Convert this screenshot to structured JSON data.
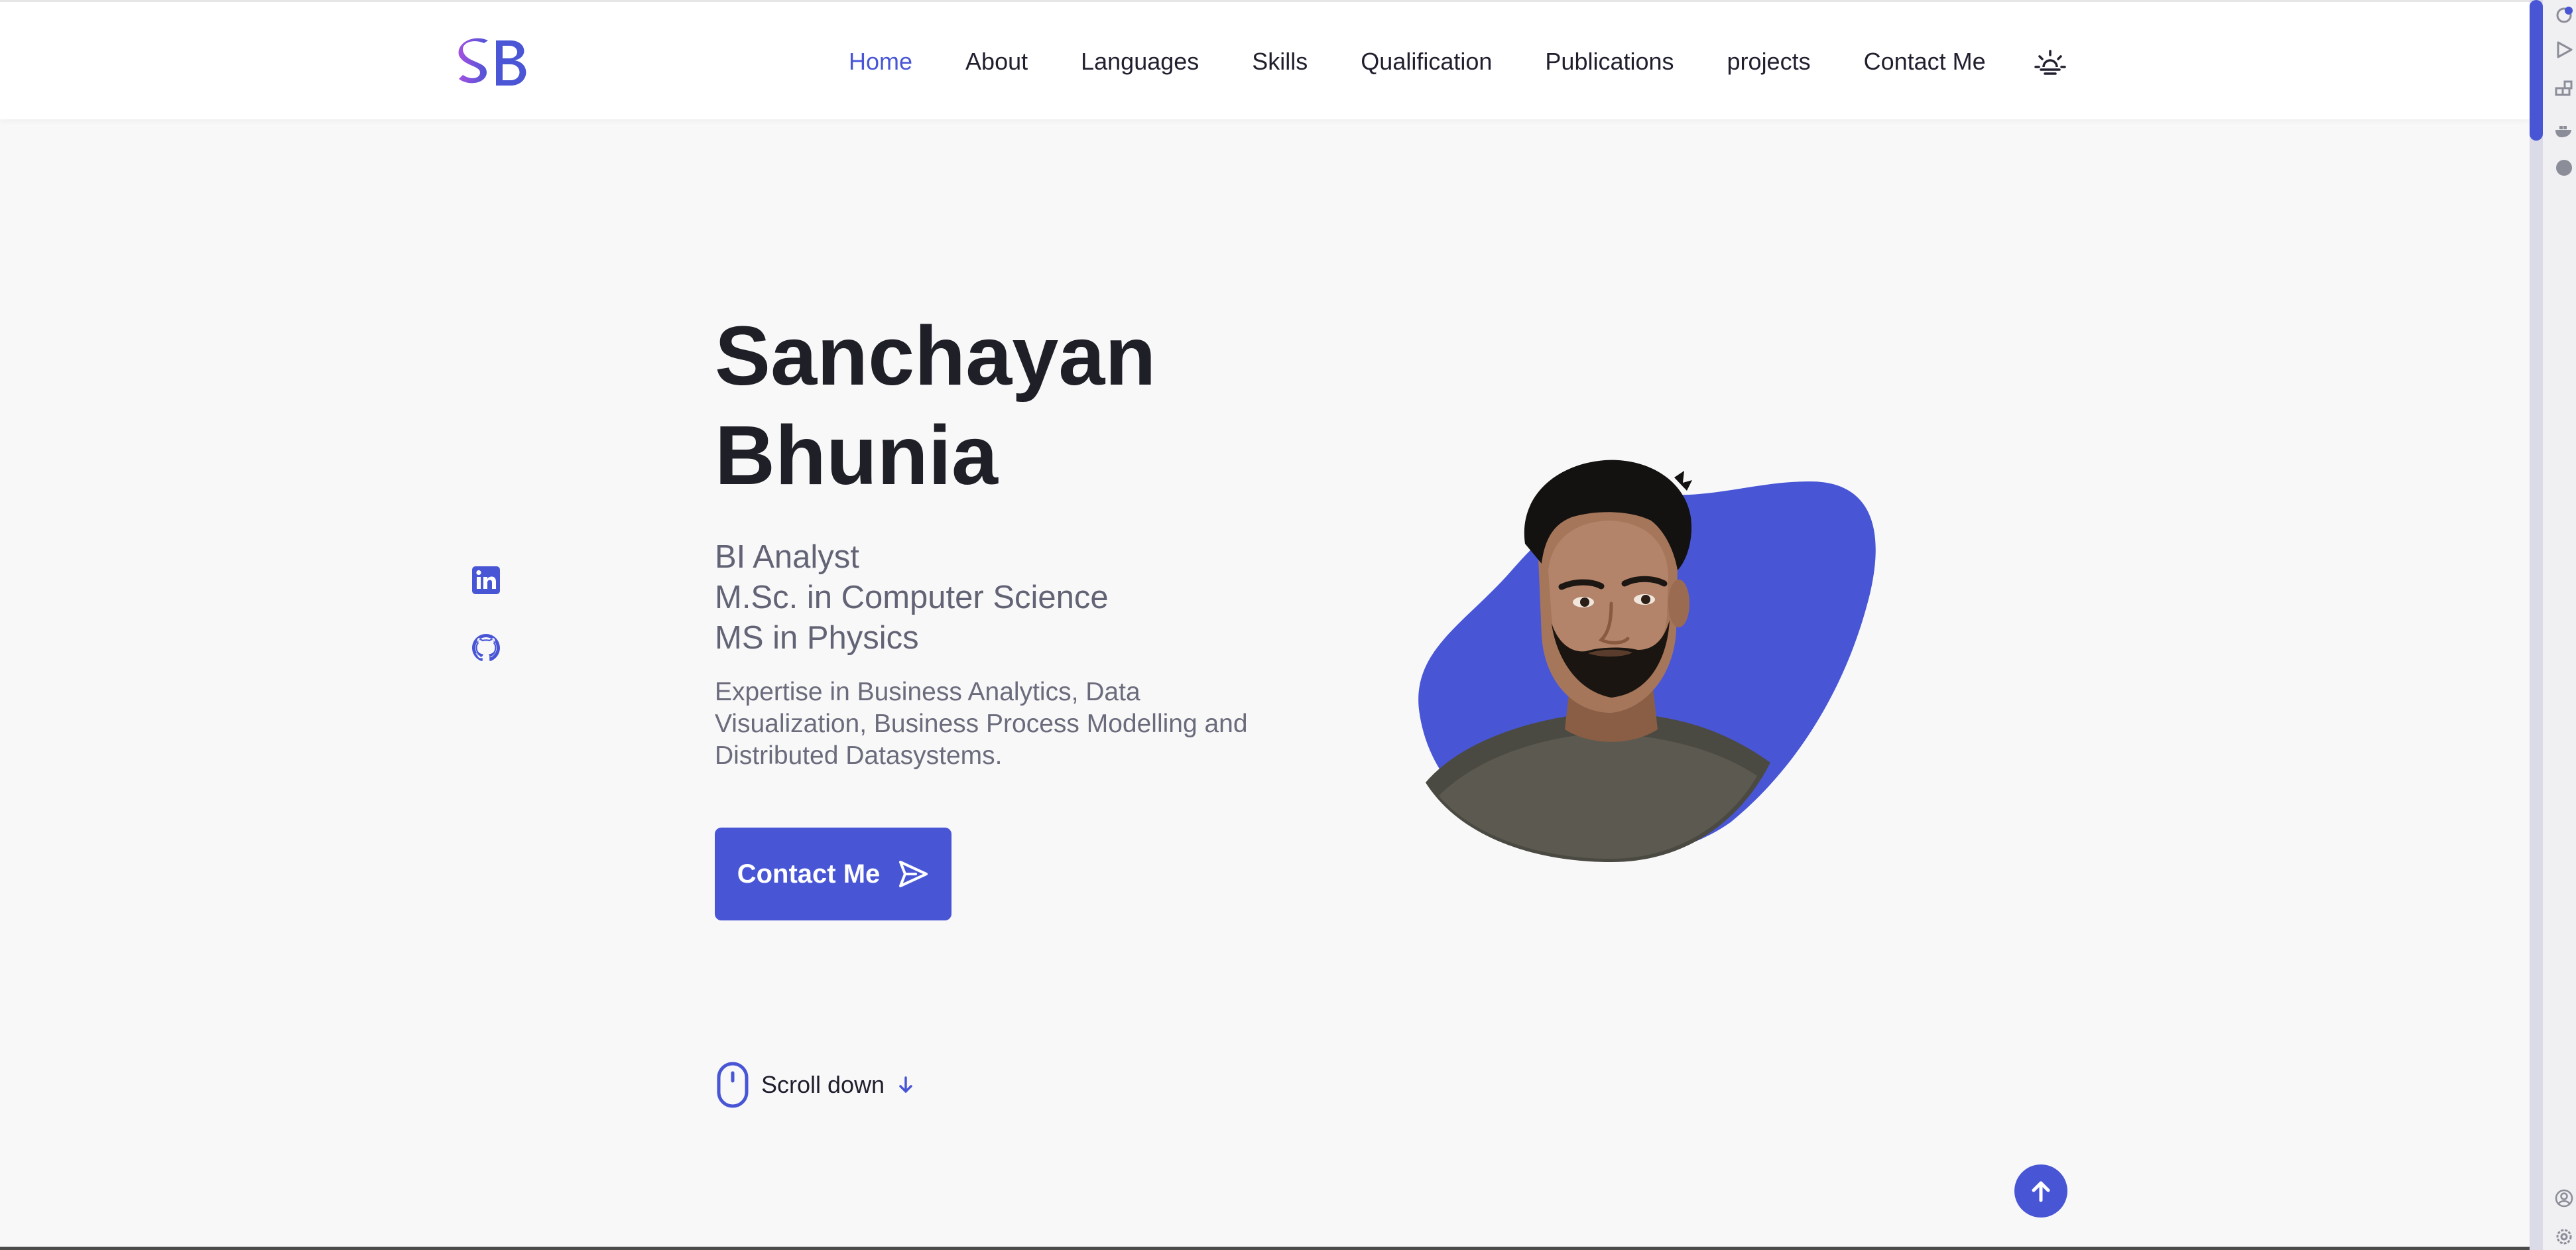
{
  "header": {
    "logo_text": "SB",
    "nav_items": [
      {
        "label": "Home",
        "active": true
      },
      {
        "label": "About"
      },
      {
        "label": "Languages"
      },
      {
        "label": "Skills"
      },
      {
        "label": "Qualification"
      },
      {
        "label": "Publications"
      },
      {
        "label": "projects"
      },
      {
        "label": "Contact Me"
      }
    ],
    "theme_toggle_icon": "sun-icon"
  },
  "social": [
    {
      "icon": "linkedin-icon"
    },
    {
      "icon": "github-icon"
    }
  ],
  "hero": {
    "name_line1": "Sanchayan",
    "name_line2": "Bhunia",
    "roles": [
      "BI Analyst",
      "M.Sc. in Computer Science",
      "MS in Physics"
    ],
    "description": "Expertise in Business Analytics, Data Visualization, Business Process Modelling and Distributed Datasystems.",
    "cta_label": "Contact Me",
    "cta_icon": "send-icon",
    "photo_alt": "profile-photo"
  },
  "scroll_down": {
    "label": "Scroll down",
    "icon": "mouse-icon",
    "arrow_icon": "arrow-down-icon"
  },
  "back_to_top_icon": "arrow-up-icon",
  "colors": {
    "accent": "#4856d6",
    "text_dark": "#1f1f27",
    "text_muted": "#626375",
    "background": "#f8f8f9"
  }
}
